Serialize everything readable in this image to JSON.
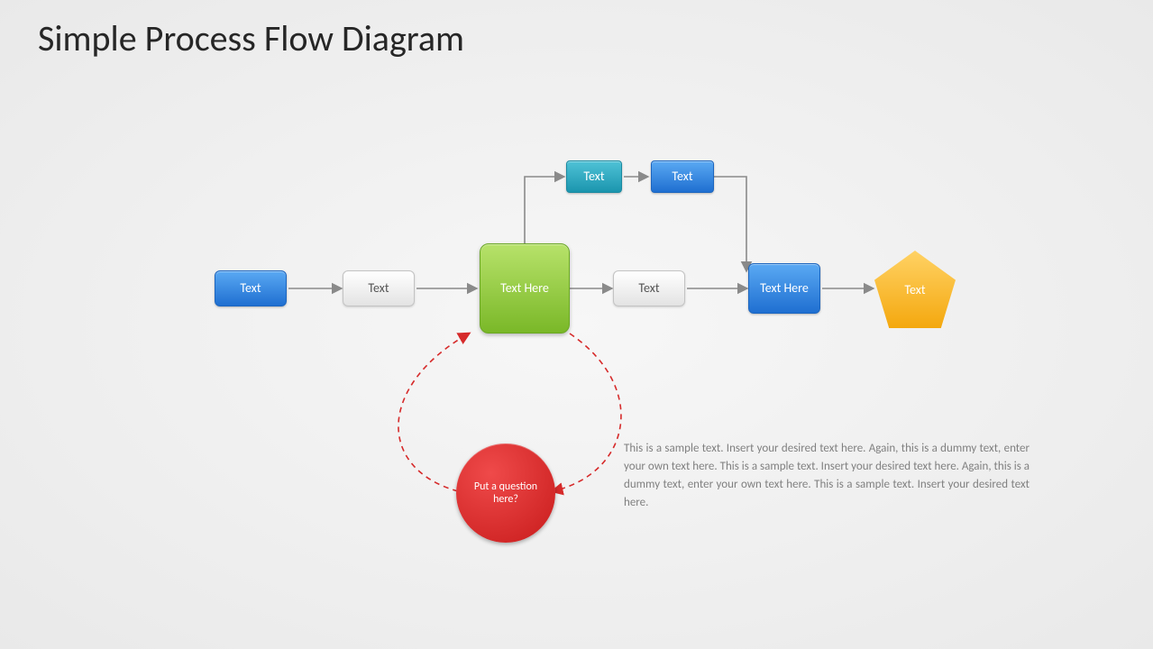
{
  "title": "Simple Process Flow Diagram",
  "nodes": {
    "n1": "Text",
    "n2": "Text",
    "n3": "Text Here",
    "n4": "Text",
    "n5": "Text Here",
    "n6": "Text",
    "t1": "Text",
    "t2": "Text",
    "q": "Put a question here?"
  },
  "description": "This is a sample text. Insert your desired text here. Again, this is a dummy text, enter your own text here. This is a sample text. Insert your desired text here. Again, this is a dummy text, enter your own text here. This is a sample text. Insert your desired text here."
}
